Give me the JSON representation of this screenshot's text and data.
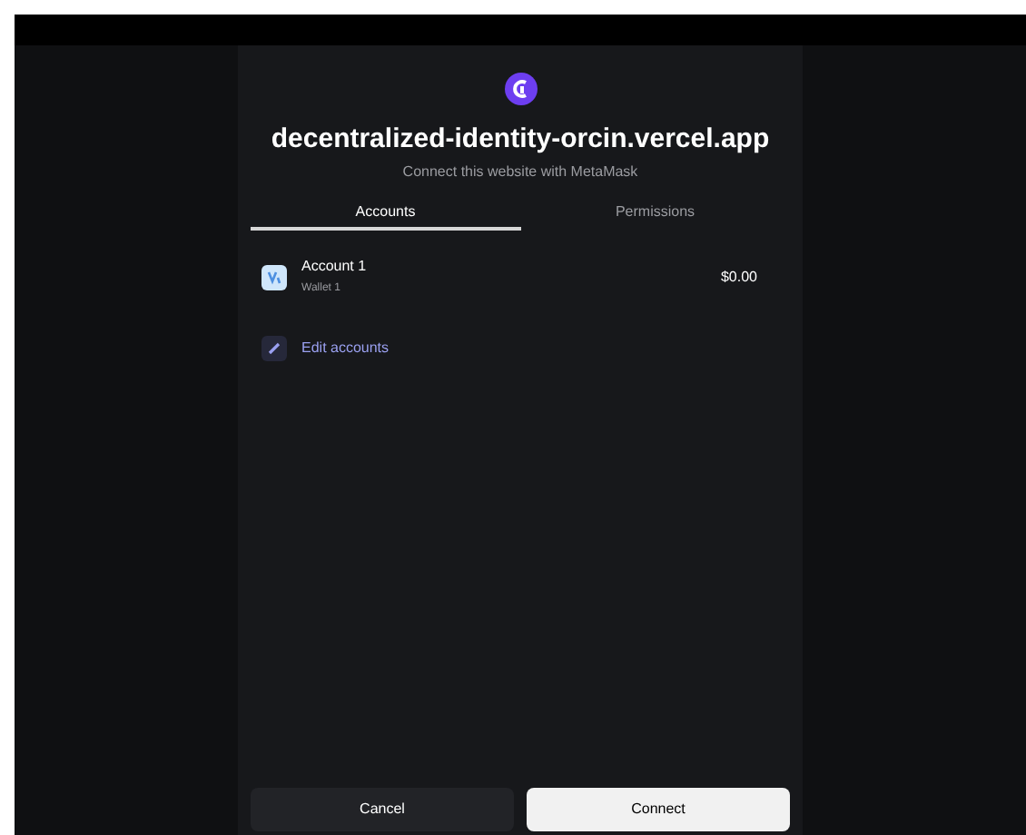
{
  "site": {
    "title": "decentralized-identity-orcin.vercel.app",
    "subtitle": "Connect this website with MetaMask"
  },
  "tabs": [
    {
      "label": "Accounts",
      "selected": true
    },
    {
      "label": "Permissions",
      "selected": false
    }
  ],
  "accounts": [
    {
      "name": "Account 1",
      "wallet": "Wallet 1",
      "balance": "$0.00"
    }
  ],
  "edit_link": "Edit accounts",
  "buttons": [
    {
      "label": "Cancel",
      "kind": "secondary"
    },
    {
      "label": "Connect",
      "kind": "primary"
    }
  ]
}
